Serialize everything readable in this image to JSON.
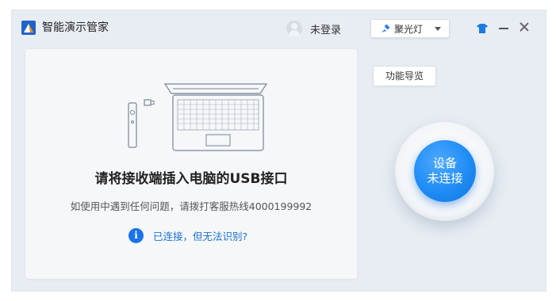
{
  "app": {
    "title": "智能演示管家"
  },
  "user": {
    "login_status": "未登录"
  },
  "mode_select": {
    "selected": "聚光灯",
    "icon": "spotlight-pointer-icon"
  },
  "window_controls": {
    "skin": "tshirt-icon",
    "minimize": "minimize-icon",
    "close": "close-icon"
  },
  "main_panel": {
    "instruction": "请将接收端插入电脑的USB接口",
    "support": "如使用中遇到任何问题，请拨打客服热线4000199992",
    "help_link": "已连接，但无法识别?",
    "info_glyph": "i"
  },
  "side_panel": {
    "tour_button": "功能导览",
    "device_status_line1": "设备",
    "device_status_line2": "未连接"
  },
  "colors": {
    "accent": "#1a73e8",
    "status_blue": "#1f8cf5",
    "window_bg": "#e8edf3",
    "panel_bg": "#f5f7f9"
  }
}
